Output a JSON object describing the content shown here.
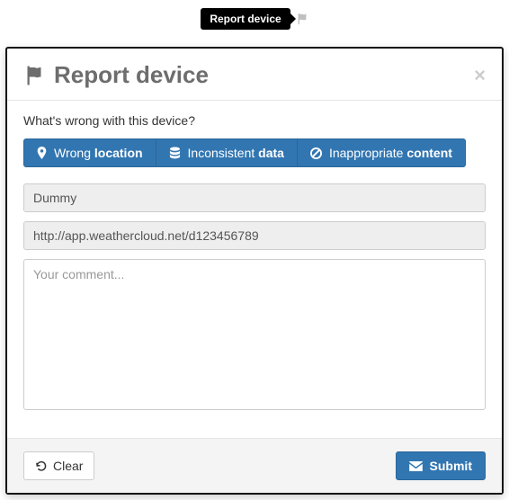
{
  "tooltip": {
    "label": "Report device"
  },
  "modal": {
    "title": "Report device",
    "prompt": "What's wrong with this device?",
    "options": [
      {
        "thin": "Wrong ",
        "bold": "location"
      },
      {
        "thin": "Inconsistent ",
        "bold": "data"
      },
      {
        "thin": "Inappropriate ",
        "bold": "content"
      }
    ],
    "name_field": "Dummy",
    "url_field": "http://app.weathercloud.net/d123456789",
    "comment_placeholder": "Your comment..."
  },
  "footer": {
    "clear": "Clear",
    "submit": "Submit"
  }
}
